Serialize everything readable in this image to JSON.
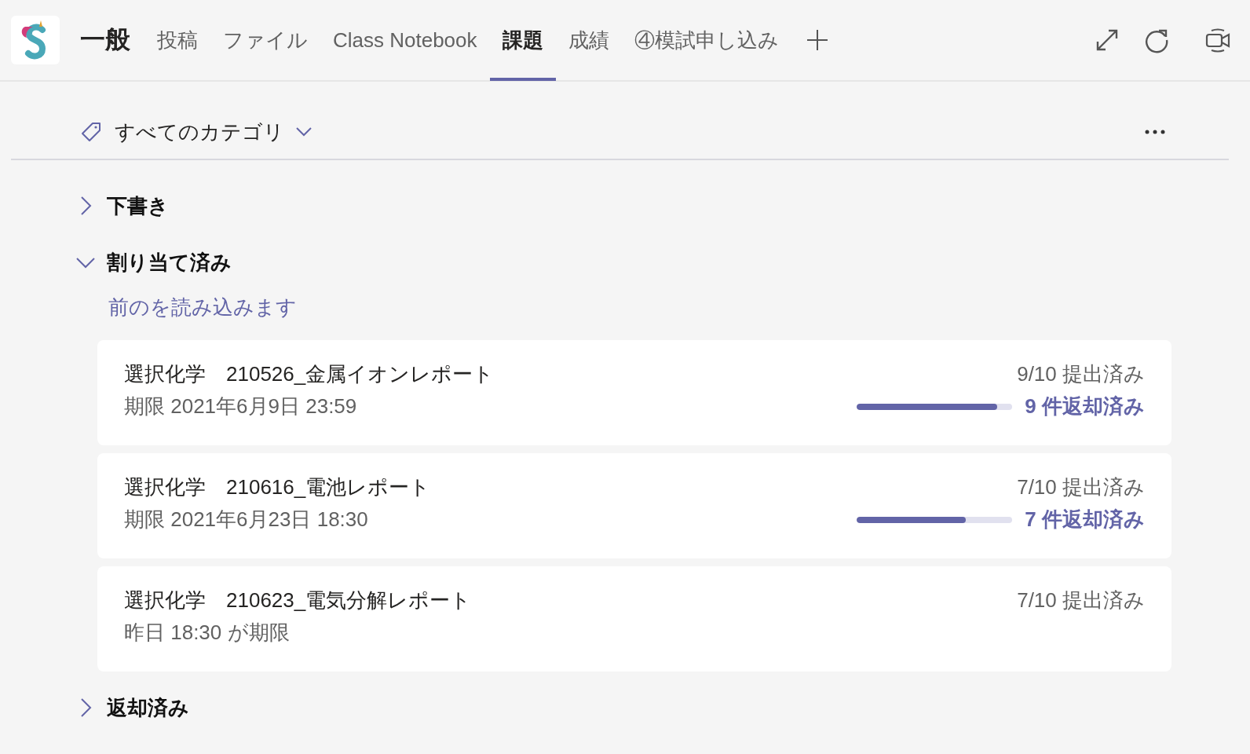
{
  "header": {
    "title": "一般",
    "tabs": [
      {
        "label": "投稿",
        "selected": false
      },
      {
        "label": "ファイル",
        "selected": false
      },
      {
        "label": "Class Notebook",
        "selected": false
      },
      {
        "label": "課題",
        "selected": true
      },
      {
        "label": "成績",
        "selected": false
      },
      {
        "label": "④模試申し込み",
        "selected": false
      }
    ]
  },
  "filter": {
    "label": "すべてのカテゴリ"
  },
  "sections": [
    {
      "title": "下書き",
      "expanded": false
    },
    {
      "title": "割り当て済み",
      "expanded": true,
      "load_more": "前のを読み込みます",
      "assignments": [
        {
          "title": "選択化学　210526_金属イオンレポート",
          "due": "期限 2021年6月9日 23:59",
          "submitted": "9/10 提出済み",
          "returned": "9 件返却済み",
          "level": 0.9
        },
        {
          "title": "選択化学　210616_電池レポート",
          "due": "期限 2021年6月23日 18:30",
          "submitted": "7/10 提出済み",
          "returned": "7 件返却済み",
          "level": 0.7
        },
        {
          "title": "選択化学　210623_電気分解レポート",
          "due": "昨日 18:30 が期限",
          "submitted": "7/10 提出済み"
        }
      ]
    },
    {
      "title": "返却済み",
      "expanded": false
    }
  ]
}
